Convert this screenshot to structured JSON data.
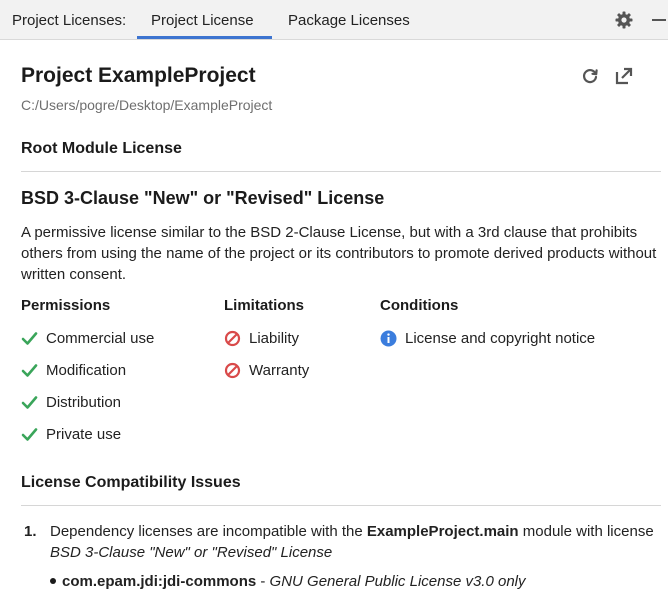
{
  "tabbar": {
    "caption": "Project Licenses:",
    "tabs": [
      {
        "label": "Project License",
        "selected": true
      },
      {
        "label": "Package Licenses",
        "selected": false
      }
    ],
    "accent": "#3d74d0"
  },
  "project": {
    "title": "Project ExampleProject",
    "path": "C:/Users/pogre/Desktop/ExampleProject"
  },
  "root_module": {
    "heading": "Root Module License"
  },
  "license": {
    "name": "BSD 3-Clause \"New\" or \"Revised\" License",
    "description": "A permissive license similar to the BSD 2-Clause License, but with a 3rd clause that prohibits others from using the name of the project or its contributors to promote derived products without written consent.",
    "permissions": {
      "heading": "Permissions",
      "items": [
        "Commercial use",
        "Modification",
        "Distribution",
        "Private use"
      ]
    },
    "limitations": {
      "heading": "Limitations",
      "items": [
        "Liability",
        "Warranty"
      ]
    },
    "conditions": {
      "heading": "Conditions",
      "items": [
        "License and copyright notice"
      ]
    }
  },
  "compatibility": {
    "heading": "License Compatibility Issues",
    "issues": [
      {
        "number": "1.",
        "text_before": "Dependency licenses are incompatible with the ",
        "module": "ExampleProject.main",
        "text_after": " module with license ",
        "license": "BSD 3-Clause \"New\" or \"Revised\" License",
        "dependency": "com.epam.jdi:jdi-commons",
        "separator": " - ",
        "dependency_license": "GNU General Public License v3.0 only"
      }
    ]
  },
  "colors": {
    "check": "#3aa55a",
    "limit": "#d94a4a",
    "info": "#3b7ddd"
  },
  "icons": {
    "gear": "gear-icon",
    "minimize": "minimize-icon",
    "refresh": "refresh-icon",
    "open_external": "open-external-icon",
    "check": "check-icon",
    "no": "prohibited-icon",
    "info": "info-icon"
  }
}
